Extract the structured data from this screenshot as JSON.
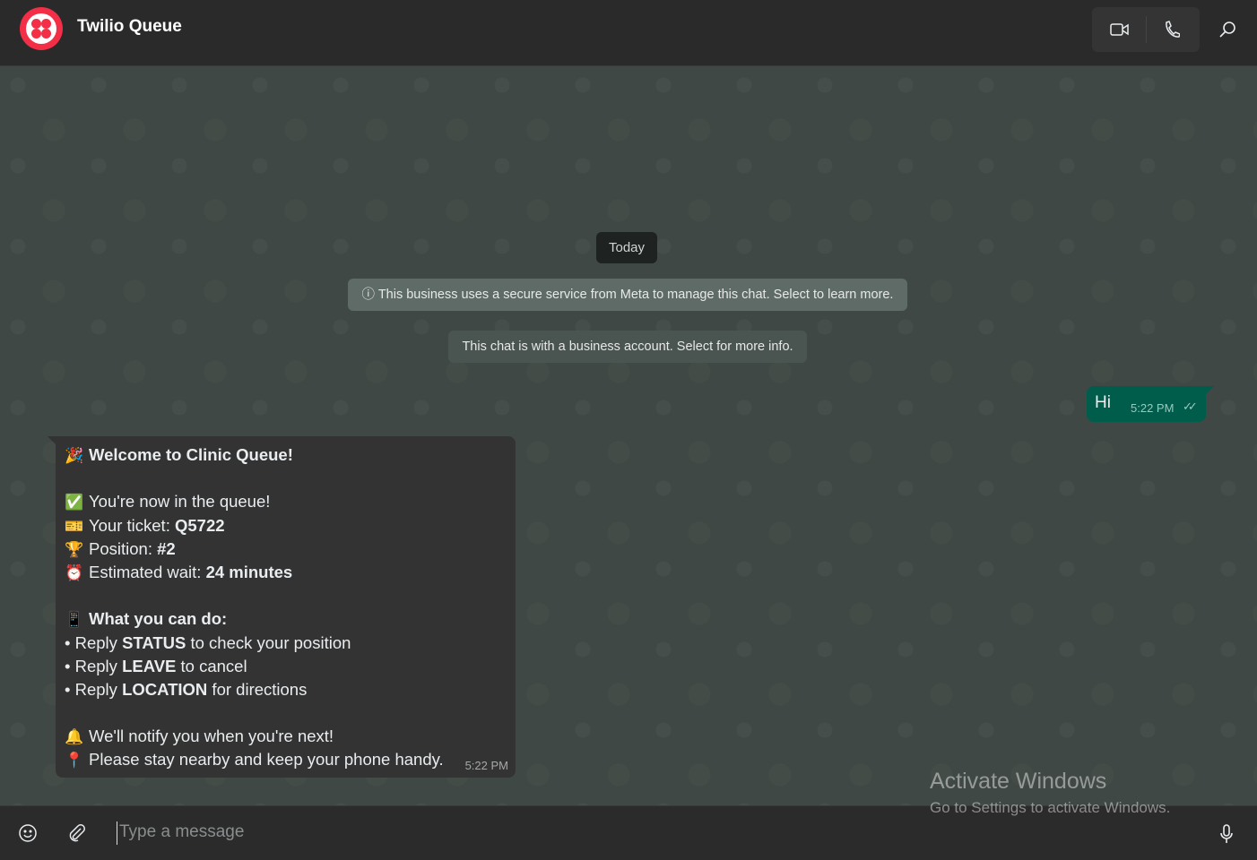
{
  "header": {
    "title": "Twilio Queue",
    "icons": [
      "video-icon",
      "phone-icon",
      "search-icon"
    ],
    "brand_color": "#f22f46"
  },
  "chat": {
    "date_label": "Today",
    "meta_notice": "ⓘ This business uses a secure service from Meta to manage this chat. Select to learn more.",
    "business_notice": "This chat is with a business account. Select for more info.",
    "outgoing": {
      "text": "Hi",
      "time": "5:22 PM",
      "status": "read"
    },
    "incoming": {
      "time": "5:22 PM",
      "lines": [
        {
          "emoji": "🎉",
          "text": "",
          "bold": "Welcome to Clinic Queue!",
          "after": ""
        },
        {
          "emoji": "",
          "text": "",
          "bold": "",
          "after": ""
        },
        {
          "emoji": "✅",
          "text": "You're now in the queue!",
          "bold": "",
          "after": ""
        },
        {
          "emoji": "🎫",
          "text": "Your ticket: ",
          "bold": "Q5722",
          "after": ""
        },
        {
          "emoji": "🏆",
          "text": "Position: ",
          "bold": "#2",
          "after": ""
        },
        {
          "emoji": "⏰",
          "text": "Estimated wait: ",
          "bold": "24 minutes",
          "after": ""
        },
        {
          "emoji": "",
          "text": "",
          "bold": "",
          "after": ""
        },
        {
          "emoji": "📱",
          "text": "",
          "bold": "What you can do:",
          "after": ""
        },
        {
          "emoji": "",
          "text": "• Reply ",
          "bold": "STATUS",
          "after": " to check your position"
        },
        {
          "emoji": "",
          "text": "• Reply ",
          "bold": "LEAVE",
          "after": " to cancel"
        },
        {
          "emoji": "",
          "text": "• Reply ",
          "bold": "LOCATION",
          "after": " for directions"
        },
        {
          "emoji": "",
          "text": "",
          "bold": "",
          "after": ""
        },
        {
          "emoji": "🔔",
          "text": "We'll notify you when you're next!",
          "bold": "",
          "after": ""
        },
        {
          "emoji": "📍",
          "text": "Please stay nearby and keep your phone handy.",
          "bold": "",
          "after": ""
        }
      ]
    }
  },
  "composer": {
    "placeholder": "Type a message"
  },
  "watermark": {
    "title": "Activate Windows",
    "subtitle": "Go to Settings to activate Windows."
  }
}
